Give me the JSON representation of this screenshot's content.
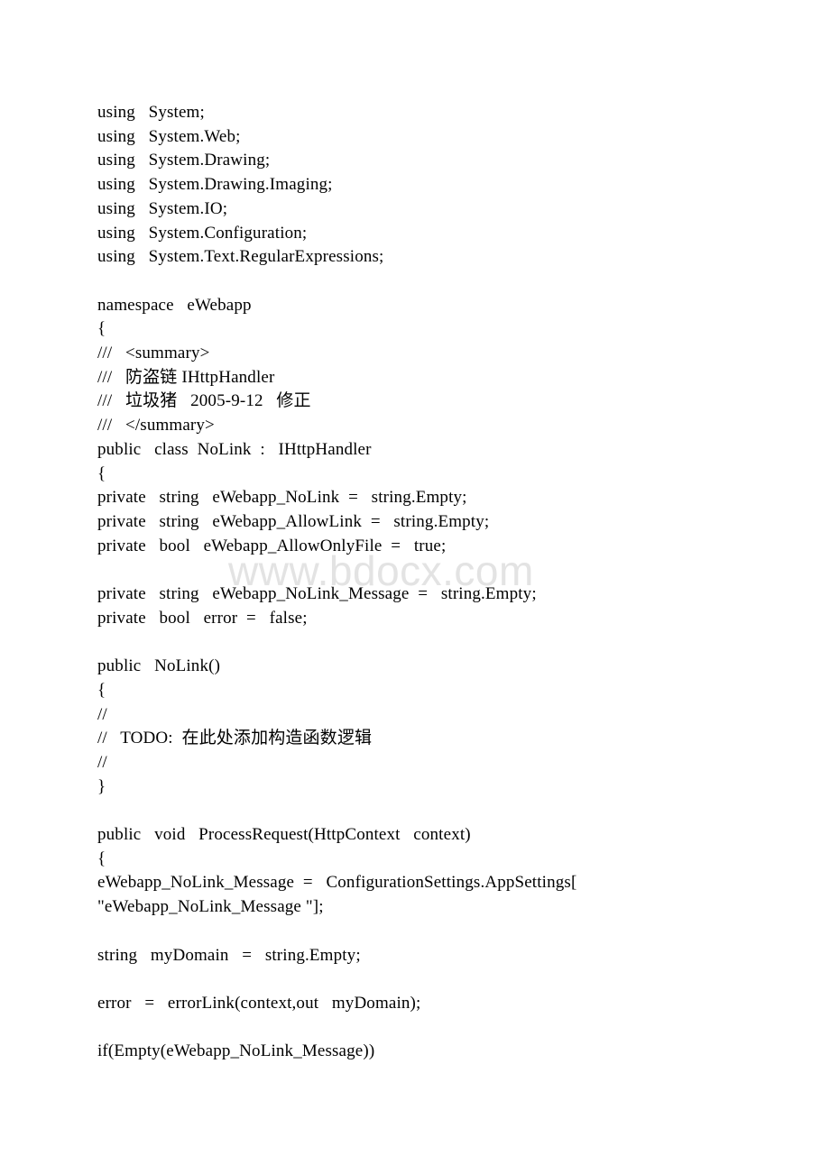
{
  "document": {
    "background_color": "#ffffff",
    "text_color": "#000000",
    "language": "csharp"
  },
  "watermark": {
    "text": "www.bdocx.com",
    "color": "#e3e3e3"
  },
  "code": {
    "lines": [
      "using   System;",
      "using   System.Web;",
      "using   System.Drawing;",
      "using   System.Drawing.Imaging;",
      "using   System.IO;",
      "using   System.Configuration;",
      "using   System.Text.RegularExpressions;",
      "",
      "namespace   eWebapp",
      "{",
      "///   <summary>",
      "///   防盗链 IHttpHandler",
      "///   垃圾猪   2005-9-12   修正",
      "///   </summary>",
      "public   class  NoLink  :   IHttpHandler",
      "{",
      "private   string   eWebapp_NoLink  =   string.Empty;",
      "private   string   eWebapp_AllowLink  =   string.Empty;",
      "private   bool   eWebapp_AllowOnlyFile  =   true;",
      "",
      "private   string   eWebapp_NoLink_Message  =   string.Empty;",
      "private   bool   error  =   false;",
      "",
      "public   NoLink()",
      "{",
      "//",
      "//   TODO:  在此处添加构造函数逻辑",
      "//",
      "}",
      "",
      "public   void   ProcessRequest(HttpContext   context)",
      "{",
      "eWebapp_NoLink_Message  =   ConfigurationSettings.AppSettings[",
      "\"eWebapp_NoLink_Message \"];",
      "",
      "string   myDomain   =   string.Empty;",
      "",
      "error   =   errorLink(context,out   myDomain);",
      "",
      "if(Empty(eWebapp_NoLink_Message))"
    ]
  }
}
